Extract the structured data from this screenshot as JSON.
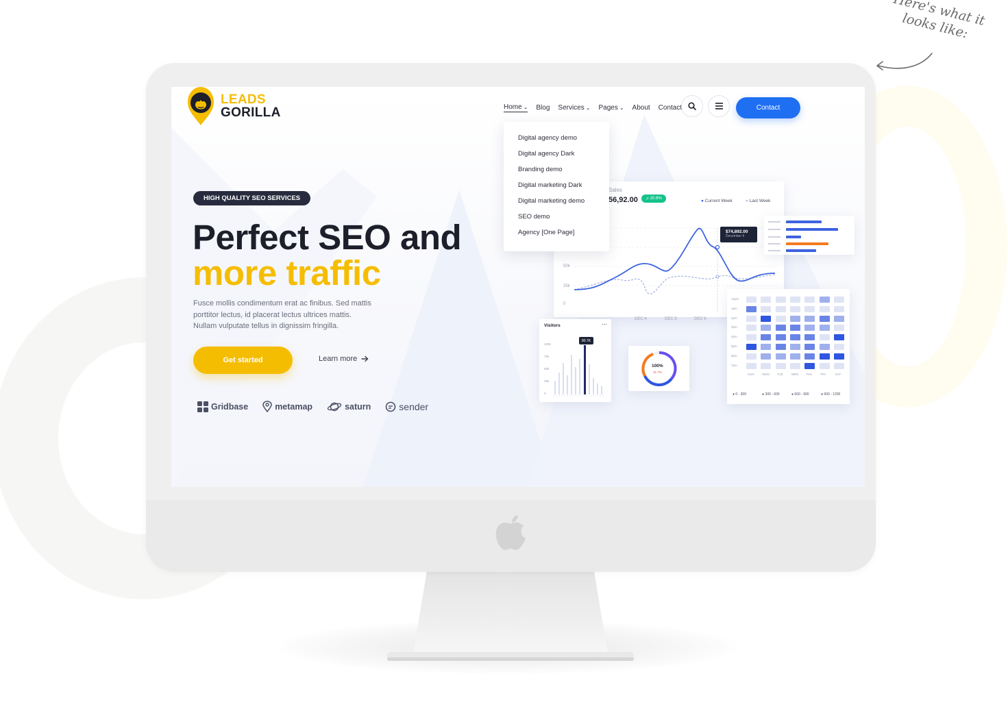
{
  "annotation": {
    "line1": "Here's what it",
    "line2": "looks like:"
  },
  "logo": {
    "line1": "LEADS",
    "line2": "GORILLA"
  },
  "nav": {
    "items": [
      {
        "label": "Home",
        "dropdown": true
      },
      {
        "label": "Blog",
        "dropdown": false
      },
      {
        "label": "Services",
        "dropdown": true
      },
      {
        "label": "Pages",
        "dropdown": true
      },
      {
        "label": "About",
        "dropdown": false
      },
      {
        "label": "Contact",
        "dropdown": false
      }
    ],
    "search_icon": "search-icon",
    "menu_icon": "hamburger-menu-icon",
    "contact_button": "Contact"
  },
  "dropdown": {
    "items": [
      "Digital agency demo",
      "Digital agency Dark",
      "Branding demo",
      "Digital marketing Dark",
      "Digital marketing demo",
      "SEO demo",
      "Agency [One Page]"
    ]
  },
  "hero": {
    "badge": "HIGH QUALITY SEO SERVICES",
    "title_line1": "Perfect SEO and",
    "title_line2": "more traffic",
    "desc_line1": "Fusce mollis condimentum erat ac finibus. Sed mattis",
    "desc_line2": "porttitor lectus, id placerat lectus ultrices mattis.",
    "desc_line3": "Nullam vulputate tellus in dignissim fringilla.",
    "cta_primary": "Get started",
    "cta_secondary": "Learn more"
  },
  "brands": [
    "Gridbase",
    "metamap",
    "saturn",
    "sender"
  ],
  "sales_card": {
    "label": "Sales",
    "value": "56,92.00",
    "change": "20.8%",
    "legend_current": "Current Week",
    "legend_last": "Last Week",
    "tooltip_value": "$74,892.00",
    "tooltip_date": "December 6",
    "y_ticks": [
      "50k",
      "25k",
      "0"
    ],
    "x_ticks": [
      "DEC 4",
      "DEC 5",
      "DEC 6"
    ]
  },
  "visitors_card": {
    "title": "Visitors",
    "tooltip": "80.7K",
    "y_ticks": [
      "100k",
      "75k",
      "50k",
      "25k",
      "0"
    ]
  },
  "donut_card": {
    "value": "100%",
    "sub": "31.7%"
  },
  "heatmap_card": {
    "rows": [
      "12pm",
      "1pm",
      "2pm",
      "3pm",
      "4pm",
      "5pm",
      "6pm",
      "7pm"
    ],
    "cols": [
      "SUN",
      "MON",
      "TUE",
      "WED",
      "THU",
      "FRI",
      "SAT"
    ],
    "legend": [
      "0 - 300",
      "300 - 600",
      "600 - 900",
      "900 - 1200"
    ]
  },
  "colors": {
    "brand_yellow": "#f5bd02",
    "brand_blue": "#1f6ff2",
    "dark": "#1d1f2a"
  }
}
